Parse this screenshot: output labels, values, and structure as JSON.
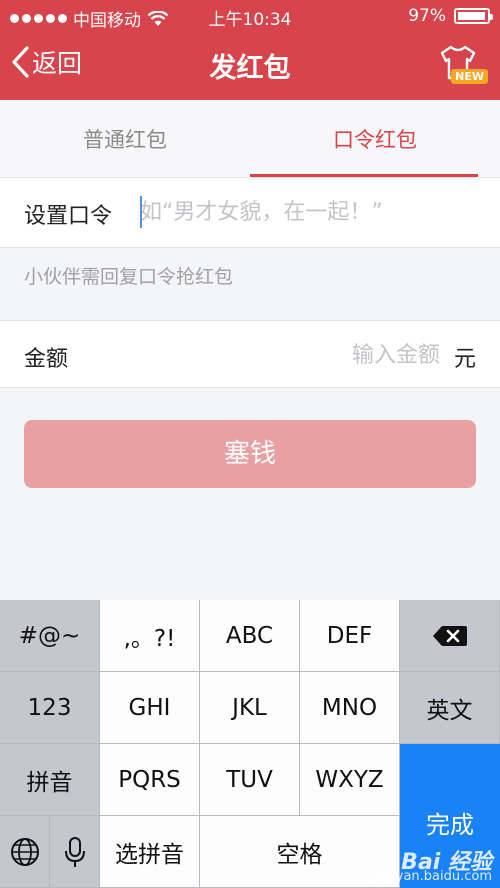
{
  "status_bar": {
    "carrier": "中国移动",
    "time": "上午10:34",
    "battery": "97%",
    "battery_level": 0.97
  },
  "nav": {
    "back_label": "返回",
    "title": "发红包",
    "badge": "NEW",
    "skin_icon": "tshirt-icon"
  },
  "tabs": [
    {
      "label": "普通红包",
      "active": false
    },
    {
      "label": "口令红包",
      "active": true
    }
  ],
  "password": {
    "label": "设置口令",
    "placeholder": "如“男才女貌，在一起！”",
    "value": ""
  },
  "hint": "小伙伴需回复口令抢红包",
  "amount": {
    "label": "金额",
    "placeholder": "输入金额",
    "unit": "元",
    "value": ""
  },
  "submit_label": "塞钱",
  "keyboard": {
    "row1": [
      "#@~",
      ",。?!",
      "ABC",
      "DEF"
    ],
    "row2": [
      "123",
      "GHI",
      "JKL",
      "MNO",
      "英文"
    ],
    "row3": [
      "拼音",
      "PQRS",
      "TUV",
      "WXYZ"
    ],
    "row4": [
      "选拼音",
      "空格"
    ],
    "done": "完成",
    "delete_icon": "backspace-icon",
    "globe_icon": "globe-icon",
    "mic_icon": "microphone-icon"
  },
  "watermark": {
    "brand": "Bai 经验",
    "url": "jingyan.baidu.com"
  },
  "colors": {
    "brand_red": "#d8444b",
    "button_disabled": "#e8a0a3",
    "keyboard_blue": "#1a82f7"
  }
}
